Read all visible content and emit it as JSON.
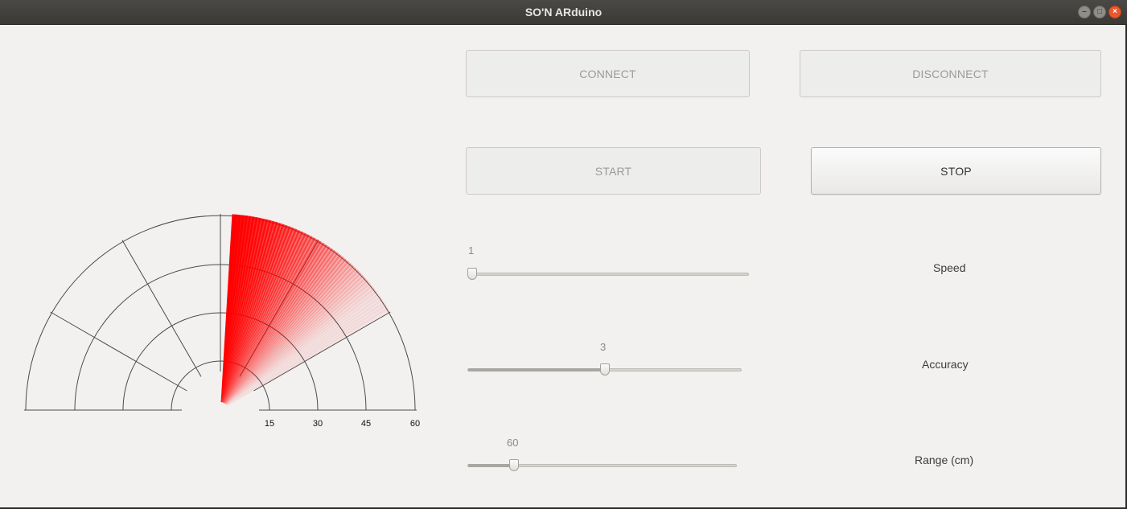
{
  "window": {
    "title": "SO'N ARduino"
  },
  "wm": {
    "minimize": "–",
    "maximize": "□",
    "close": "×"
  },
  "buttons": {
    "connect": "CONNECT",
    "disconnect": "DISCONNECT",
    "start": "START",
    "stop": "STOP"
  },
  "sliders": {
    "speed": {
      "label": "Speed",
      "value": "1",
      "fraction": 0.0
    },
    "accuracy": {
      "label": "Accuracy",
      "value": "3",
      "fraction": 0.5
    },
    "range": {
      "label": "Range (cm)",
      "value": "60",
      "fraction": 0.17
    }
  },
  "radar": {
    "ticks": [
      "15",
      "30",
      "45",
      "60"
    ],
    "sweep_color": "#ff0000",
    "sweep_from_deg": 30,
    "sweep_to_deg": 86
  }
}
